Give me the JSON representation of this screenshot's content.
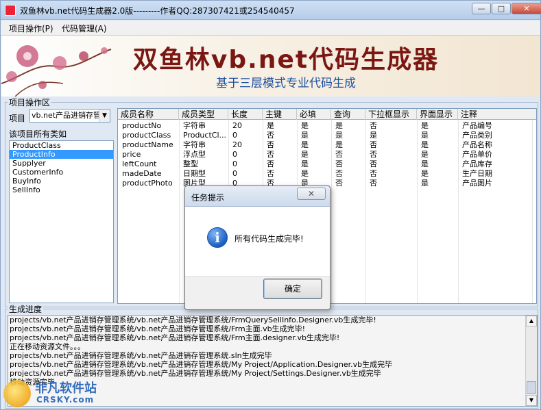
{
  "window": {
    "title": "双鱼林vb.net代码生成器2.0版---------作者QQ:287307421或254540457",
    "minimize_glyph": "—",
    "maximize_glyph": "□",
    "close_glyph": "✕"
  },
  "menubar": {
    "items": [
      "项目操作(P)",
      "代码管理(A)"
    ]
  },
  "banner": {
    "title": "双鱼林vb.net代码生成器",
    "subtitle": "基于三层模式专业代码生成"
  },
  "project_panel": {
    "group_label": "项目操作区",
    "project_label": "项目",
    "project_selected": "vb.net产品进销存管",
    "classes_label": "该项目所有类如",
    "classes": [
      "ProductClass",
      "ProductInfo",
      "Supplyer",
      "CustomerInfo",
      "BuyInfo",
      "SellInfo"
    ],
    "selected_class_index": 1
  },
  "grid": {
    "columns": [
      "成员名称",
      "成员类型",
      "长度",
      "主键",
      "必填",
      "查询",
      "下拉框显示",
      "界面显示",
      "注释"
    ],
    "rows": [
      [
        "productNo",
        "字符串",
        "20",
        "是",
        "是",
        "是",
        "否",
        "是",
        "产品编号"
      ],
      [
        "productClass",
        "ProductCl...",
        "0",
        "否",
        "是",
        "是",
        "是",
        "是",
        "产品类别"
      ],
      [
        "productName",
        "字符串",
        "20",
        "否",
        "是",
        "是",
        "否",
        "是",
        "产品名称"
      ],
      [
        "price",
        "浮点型",
        "0",
        "否",
        "是",
        "否",
        "否",
        "是",
        "产品单价"
      ],
      [
        "leftCount",
        "整型",
        "0",
        "否",
        "是",
        "否",
        "否",
        "是",
        "产品库存"
      ],
      [
        "madeDate",
        "日期型",
        "0",
        "否",
        "是",
        "否",
        "否",
        "是",
        "生产日期"
      ],
      [
        "productPhoto",
        "图片型",
        "0",
        "否",
        "是",
        "否",
        "否",
        "是",
        "产品图片"
      ]
    ]
  },
  "progress": {
    "group_label": "生成进度",
    "lines": [
      "projects/vb.net产品进销存管理系统/vb.net产品进销存管理系统/FrmQuerySellInfo.Designer.vb生成完毕!",
      "projects/vb.net产品进销存管理系统/vb.net产品进销存管理系统/Frm主面.vb生成完毕!",
      "projects/vb.net产品进销存管理系统/vb.net产品进销存管理系统/Frm主面.designer.vb生成完毕!",
      "正在移动资源文件。。。",
      "projects/vb.net产品进销存管理系统/vb.net产品进销存管理系统.sln生成完毕",
      "projects/vb.net产品进销存管理系统/vb.net产品进销存管理系统/My Project/Application.Designer.vb生成完毕",
      "projects/vb.net产品进销存管理系统/vb.net产品进销存管理系统/My Project/Settings.Designer.vb生成完毕",
      "移动资源完毕"
    ]
  },
  "dialog": {
    "title": "任务提示",
    "close_glyph": "✕",
    "icon": "info-icon",
    "message": "所有代码生成完毕!",
    "ok_label": "确定"
  },
  "watermark": {
    "main": "非凡软件站",
    "sub": "CRSKY.com"
  }
}
